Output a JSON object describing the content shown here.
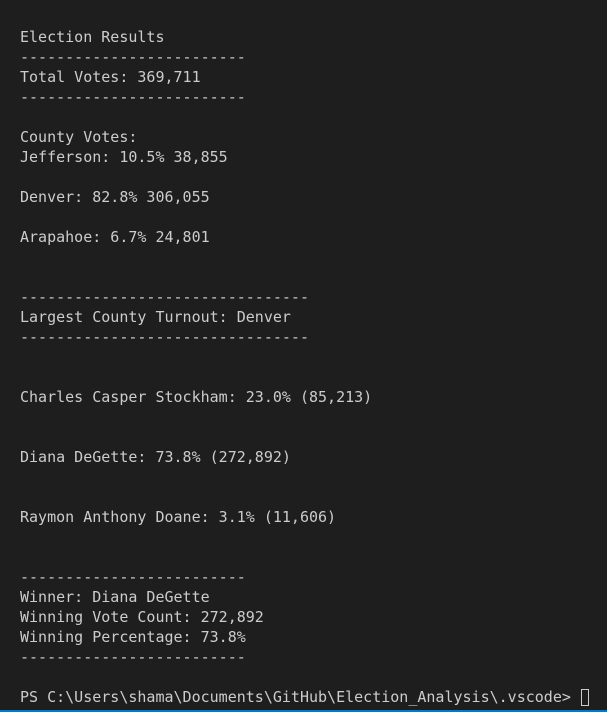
{
  "terminal": {
    "lines": [
      "Election Results",
      "-------------------------",
      "Total Votes: 369,711",
      "-------------------------",
      "",
      "County Votes:",
      "Jefferson: 10.5% 38,855",
      "",
      "Denver: 82.8% 306,055",
      "",
      "Arapahoe: 6.7% 24,801",
      "",
      "",
      "--------------------------------",
      "Largest County Turnout: Denver",
      "--------------------------------",
      "",
      "",
      "Charles Casper Stockham: 23.0% (85,213)",
      "",
      "",
      "Diana DeGette: 73.8% (272,892)",
      "",
      "",
      "Raymon Anthony Doane: 3.1% (11,606)",
      "",
      "",
      "-------------------------",
      "Winner: Diana DeGette",
      "Winning Vote Count: 272,892",
      "Winning Percentage: 73.8%",
      "-------------------------",
      ""
    ],
    "prompt": "PS C:\\Users\\shama\\Documents\\GitHub\\Election_Analysis\\.vscode> "
  },
  "colors": {
    "background": "#1e1e1e",
    "text": "#cccccc",
    "status_bar": "#007acc"
  }
}
